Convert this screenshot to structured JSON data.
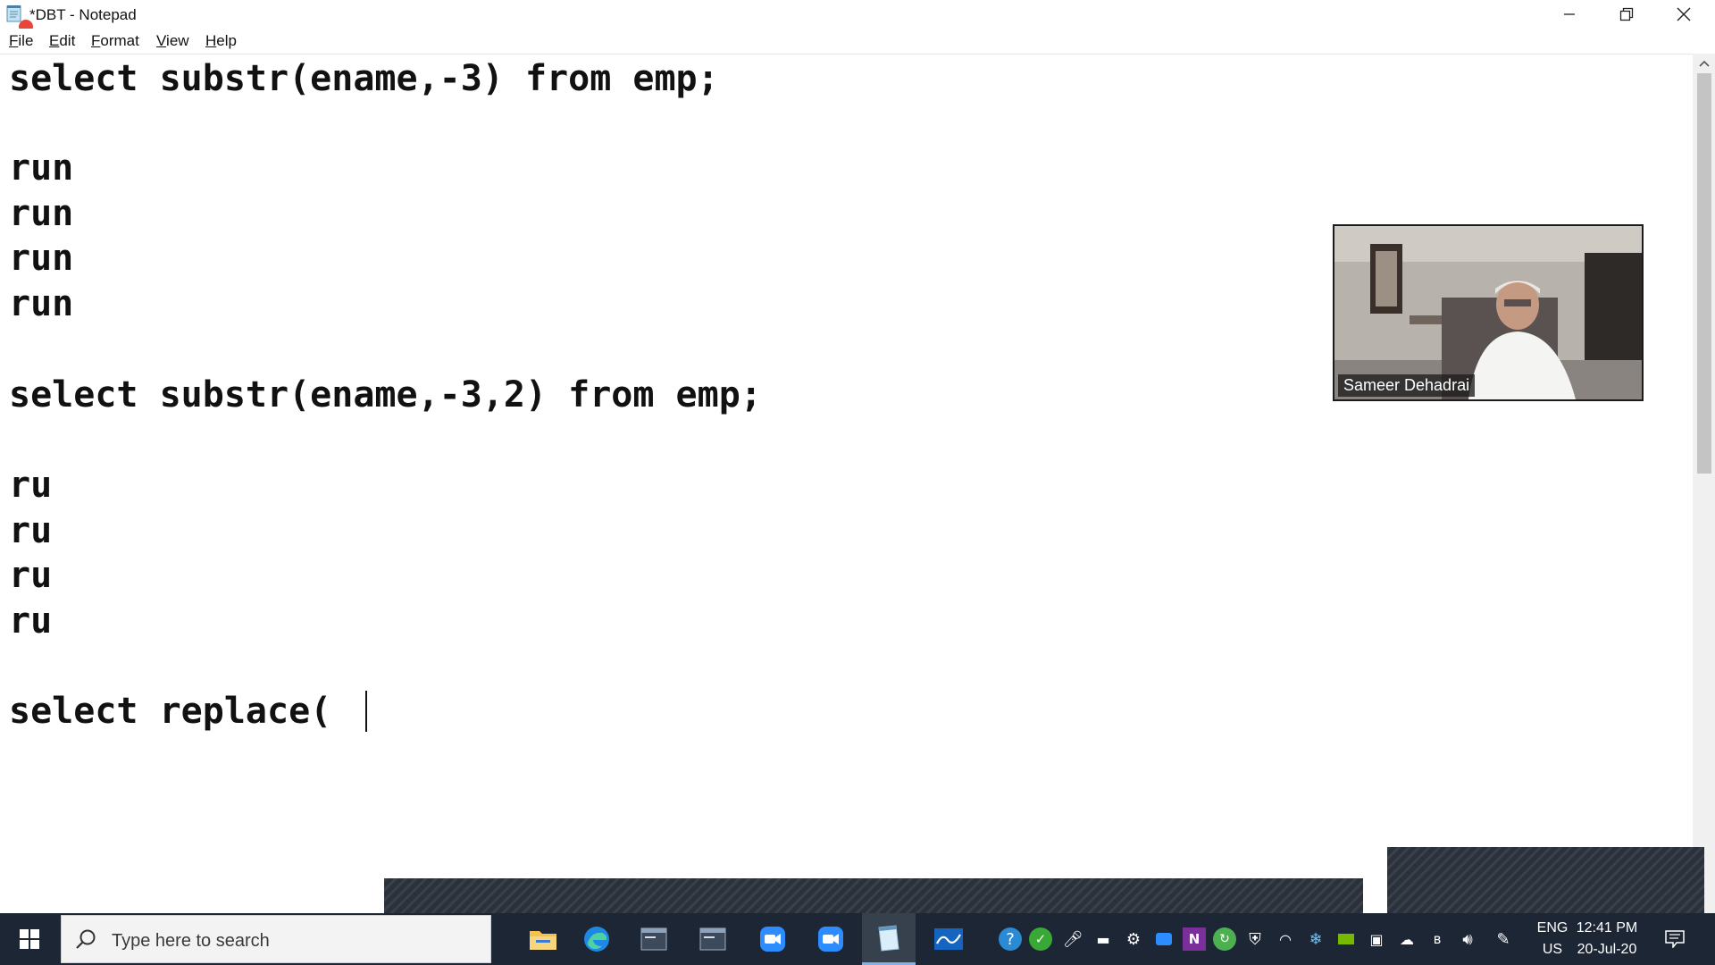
{
  "window": {
    "title": "*DBT - Notepad",
    "menu": [
      {
        "label": "File",
        "accel": "F",
        "rest": "ile"
      },
      {
        "label": "Edit",
        "accel": "E",
        "rest": "dit"
      },
      {
        "label": "Format",
        "accel": "F",
        "rest": "ormat"
      },
      {
        "label": "View",
        "accel": "V",
        "rest": "iew"
      },
      {
        "label": "Help",
        "accel": "H",
        "rest": "elp"
      }
    ]
  },
  "editor": {
    "lines": [
      "select substr(ename,-3) from emp;",
      "run",
      "run",
      "run",
      "run",
      "select substr(ename,-3,2) from emp;",
      "ru",
      "ru",
      "ru",
      "ru",
      "select replace("
    ]
  },
  "video": {
    "participant": "Sameer Dehadrai"
  },
  "taskbar": {
    "search_placeholder": "Type here to search",
    "apps": [
      "file-explorer",
      "edge",
      "sql-plus",
      "sql-plus-2",
      "zoom",
      "zoom-meeting",
      "notepad",
      "whiteboard"
    ],
    "tray": {
      "language": "ENG",
      "region": "US",
      "time": "12:41 PM",
      "date": "20-Jul-20"
    }
  },
  "colors": {
    "taskbar_bg": "#1c2635",
    "accent": "#0078d7",
    "overlay": "#2b313b"
  }
}
